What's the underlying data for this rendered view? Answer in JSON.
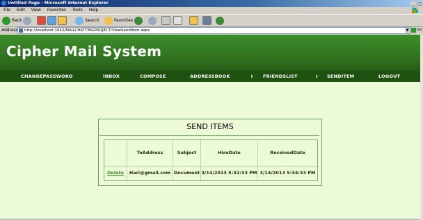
{
  "window": {
    "title": "Untitled Page - Microsoft Internet Explorer"
  },
  "menu": [
    "File",
    "Edit",
    "View",
    "Favorites",
    "Tools",
    "Help"
  ],
  "toolbar": {
    "back": "Back",
    "search": "Search",
    "favorites": "Favorites"
  },
  "address": {
    "label": "Address",
    "url": "http://localhost:1042/MAILCHATTINGPROJECT/ViewSendItem.aspx",
    "go": "Go"
  },
  "site": {
    "title": "Cipher Mail System"
  },
  "nav": [
    "CHANGEPASSWORD",
    "INBOX",
    "COMPOSE",
    "ADDRESSBOOK",
    "FRIENDSLIST",
    "SENDITEM",
    "LOGOUT"
  ],
  "panel": {
    "title": "SEND ITEMS",
    "columns": [
      "ToAddress",
      "Subject",
      "HireDate",
      "ReceivedDate"
    ],
    "rows": [
      {
        "action": "Delete",
        "to": "Hari@gmail.com",
        "subject": "Document",
        "hire": "3/14/2013 5:32:33 PM",
        "received": "3/14/2013 5:34:33 PM"
      }
    ]
  },
  "colors": {
    "header": "#2f6e1e",
    "nav": "#1f5211",
    "page_bg": "#edfad7"
  }
}
